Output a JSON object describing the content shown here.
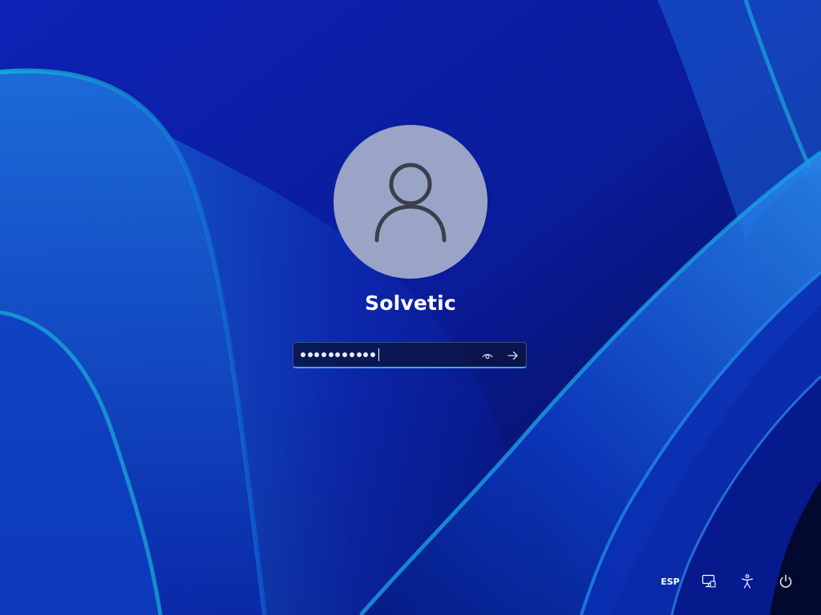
{
  "user": {
    "name": "Solvetic"
  },
  "password": {
    "masked_length": 11,
    "value": "•••••••••••"
  },
  "tray": {
    "language": "ESP"
  },
  "icons": {
    "avatar": "user-silhouette-icon",
    "reveal": "eye-icon",
    "submit": "arrow-right-icon",
    "network": "network-icon",
    "accessibility": "accessibility-icon",
    "power": "power-icon"
  },
  "colors": {
    "wallpaper_base": "#0b1fa8",
    "avatar_bg": "#9aa4c6",
    "input_focus_underline": "#4aa3e8"
  }
}
